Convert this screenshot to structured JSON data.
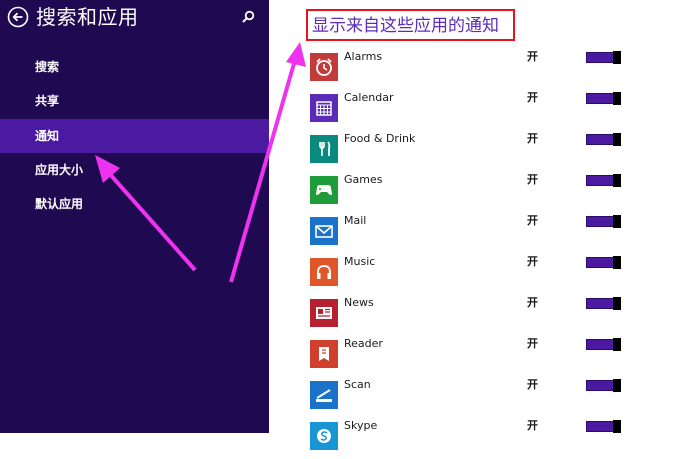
{
  "sidebar": {
    "title": "搜索和应用",
    "items": [
      {
        "label": "搜索"
      },
      {
        "label": "共享"
      },
      {
        "label": "通知",
        "selected": true
      },
      {
        "label": "应用大小"
      },
      {
        "label": "默认应用"
      }
    ]
  },
  "content": {
    "title": "显示来自这些应用的通知",
    "apps": [
      {
        "name": "Alarms",
        "state": "开",
        "on": true,
        "icon": "alarm-clock-icon",
        "tile_color": "#c23b3b"
      },
      {
        "name": "Calendar",
        "state": "开",
        "on": true,
        "icon": "calendar-icon",
        "tile_color": "#5a2bb5"
      },
      {
        "name": "Food & Drink",
        "state": "开",
        "on": true,
        "icon": "fork-knife-icon",
        "tile_color": "#0a8a7e"
      },
      {
        "name": "Games",
        "state": "开",
        "on": true,
        "icon": "game-controller-icon",
        "tile_color": "#1e9c3a"
      },
      {
        "name": "Mail",
        "state": "开",
        "on": true,
        "icon": "envelope-icon",
        "tile_color": "#1a73c9"
      },
      {
        "name": "Music",
        "state": "开",
        "on": true,
        "icon": "headphones-icon",
        "tile_color": "#e0572b"
      },
      {
        "name": "News",
        "state": "开",
        "on": true,
        "icon": "newspaper-icon",
        "tile_color": "#b7202e"
      },
      {
        "name": "Reader",
        "state": "开",
        "on": true,
        "icon": "reader-icon",
        "tile_color": "#d1402d"
      },
      {
        "name": "Scan",
        "state": "开",
        "on": true,
        "icon": "scanner-icon",
        "tile_color": "#1a73c9"
      },
      {
        "name": "Skype",
        "state": "开",
        "on": true,
        "icon": "skype-icon",
        "tile_color": "#1795d4"
      }
    ]
  },
  "colors": {
    "sidebar_bg": "#1f0a52",
    "selected_bg": "#4b1aa0",
    "toggle_on": "#4b1aa0",
    "annotation_arrow": "#ee33ee",
    "highlight_box": "#e8141c"
  }
}
